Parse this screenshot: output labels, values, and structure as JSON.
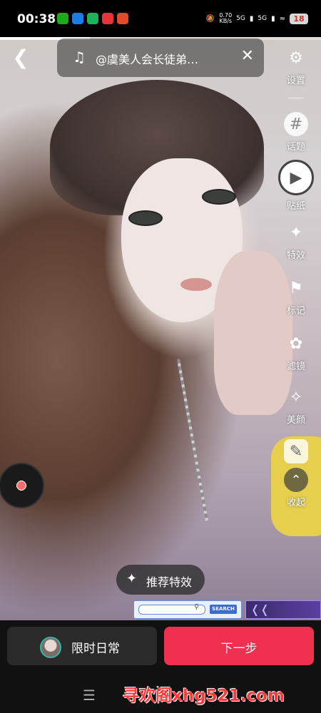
{
  "status_bar": {
    "time": "00:38",
    "net_speed": "0.70",
    "net_unit": "KB/s",
    "signal1": "5G",
    "signal2": "5G",
    "battery": "18",
    "apps": [
      {
        "name": "wechat-icon",
        "color": "#1aad19"
      },
      {
        "name": "app-blue-icon",
        "color": "#1c7ce8"
      },
      {
        "name": "app-green-icon",
        "color": "#20b25a"
      },
      {
        "name": "app-red-heart-icon",
        "color": "#e8333b"
      },
      {
        "name": "app-red-icon",
        "color": "#e24a2a"
      }
    ]
  },
  "recording_progress": 0.28,
  "music": {
    "title": "@虞美人会长徒弟…"
  },
  "toolbar": {
    "items": [
      {
        "label": "设置",
        "icon": "gear-icon"
      },
      {
        "label": "话题",
        "icon": "hashtag-icon"
      },
      {
        "label": "贴纸",
        "icon": "sticker-icon"
      },
      {
        "label": "特效",
        "icon": "sparkle-icon"
      },
      {
        "label": "标记",
        "icon": "tag-icon"
      },
      {
        "label": "滤镜",
        "icon": "filter-icon"
      },
      {
        "label": "美颜",
        "icon": "magic-wand-icon"
      },
      {
        "label": "",
        "icon": "image-edit-icon"
      },
      {
        "label": "收起",
        "icon": "chevron-up-icon"
      }
    ]
  },
  "effect_button": {
    "label": "推荐特效"
  },
  "ad_strip": {
    "search_button": "SEARCH"
  },
  "bottom": {
    "template_label": "限时日常",
    "next_label": "下一步",
    "watermark": "寻欢阁xhg521.com"
  },
  "colors": {
    "accent": "#f0304f",
    "panel": "#2a2a2a"
  }
}
